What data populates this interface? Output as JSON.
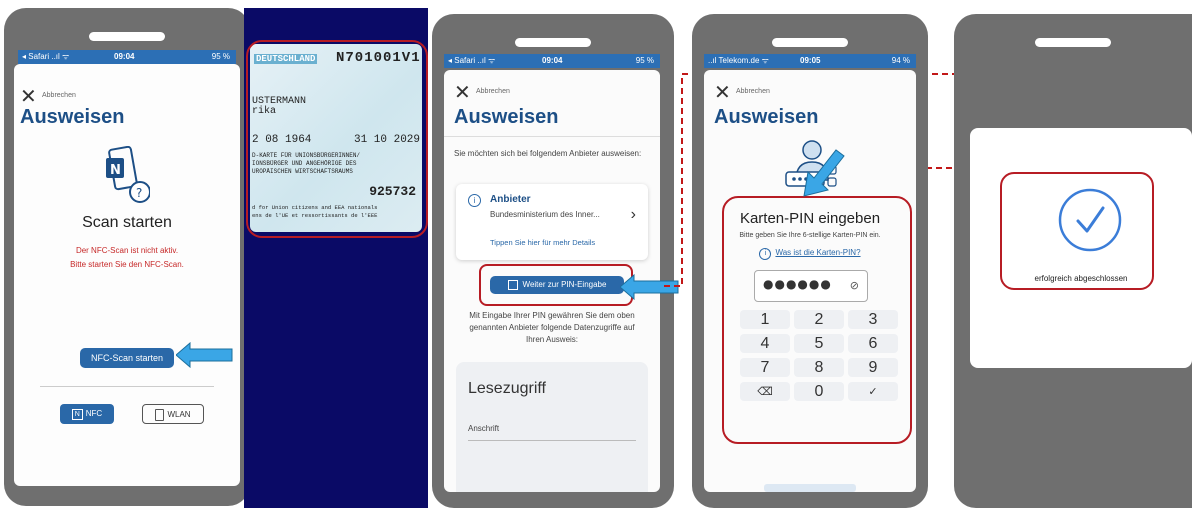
{
  "screen1": {
    "status": {
      "carrier": "◂ Safari ..ıl ᯤ",
      "time": "09:04",
      "battery": "95 %"
    },
    "cancel_label": "Abbrechen",
    "title": "Ausweisen",
    "scan_heading": "Scan starten",
    "warning_line1": "Der NFC-Scan ist nicht aktiv.",
    "warning_line2": "Bitte starten Sie den NFC-Scan.",
    "start_button": "NFC-Scan starten",
    "mode_nfc": "NFC",
    "mode_wlan": "WLAN"
  },
  "id_card": {
    "country": "DEUTSCHLAND",
    "number": "N701001V1",
    "surname": "USTERMANN",
    "given": "rika",
    "dob": "2 08 1964",
    "expiry": "31 10 2029",
    "line1": "D-KARTE FÜR UNIONSBÜRGERINNEN/",
    "line2": "IONSBÜRGER UND ANGEHÖRIGE DES",
    "line3": "UROPÄISCHEN WIRTSCHAFTSRAUMS",
    "code": "925732",
    "footer1": "d for Union citizens and EEA nationals",
    "footer2": "ens de l'UE et ressortissants de l'EEE"
  },
  "screen2": {
    "status": {
      "carrier": "◂ Safari ..ıl ᯤ",
      "time": "09:04",
      "battery": "95 %"
    },
    "cancel_label": "Abbrechen",
    "title": "Ausweisen",
    "intro": "Sie möchten sich bei folgendem Anbieter ausweisen:",
    "provider_label": "Anbieter",
    "provider_name": "Bundesministerium des Inner...",
    "details_link": "Tippen Sie hier für mehr Details",
    "pin_button": "Weiter zur PIN-Eingabe",
    "note": "Mit Eingabe Ihrer PIN gewähren Sie dem oben genannten Anbieter folgende Datenzugriffe auf Ihren Ausweis:",
    "access_title": "Lesezugriff",
    "access_item": "Anschrift"
  },
  "screen3": {
    "status": {
      "carrier": "..ıl Telekom.de ᯤ",
      "time": "09:05",
      "battery": "94 %"
    },
    "cancel_label": "Abbrechen",
    "title": "Ausweisen",
    "pin_heading": "Karten-PIN eingeben",
    "pin_instruction": "Bitte geben Sie Ihre 6-stellige Karten-PIN ein.",
    "pin_help_link": "Was ist die Karten-PIN?",
    "pin_mask": "●●●●●●",
    "keys": [
      "1",
      "2",
      "3",
      "4",
      "5",
      "6",
      "7",
      "8",
      "9",
      "⌫",
      "0",
      "✓"
    ]
  },
  "screen4": {
    "success_text": "erfolgreich abgeschlossen"
  },
  "colors": {
    "primary": "#2a68a8",
    "title": "#1d4f86",
    "highlight_red": "#b71c24",
    "arrow_blue": "#3aa6e6"
  }
}
